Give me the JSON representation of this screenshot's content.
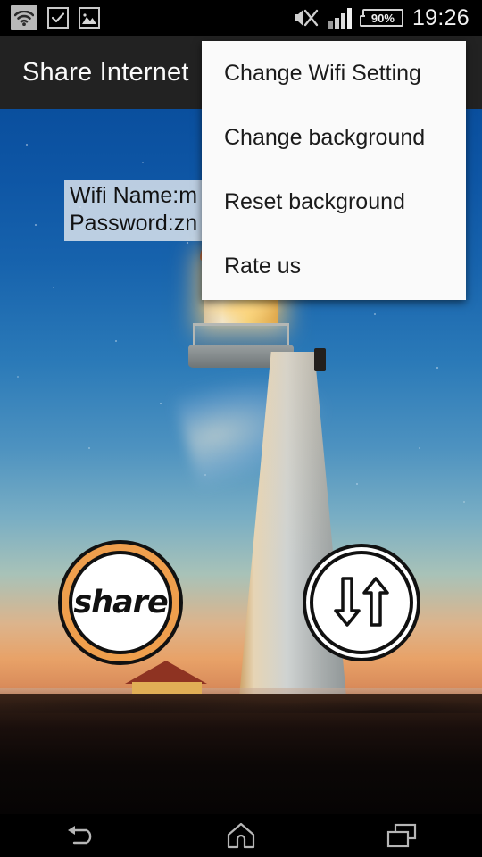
{
  "status_bar": {
    "icons": [
      "wifi-icon",
      "checkbox-icon",
      "image-icon",
      "volume-muted-icon",
      "signal-bars-icon"
    ],
    "battery_percent": "90%",
    "time": "19:26"
  },
  "action_bar": {
    "title": "Share Internet"
  },
  "wifi_info": {
    "name_line": "Wifi Name:m",
    "password_line": "Password:zn"
  },
  "buttons": {
    "share_label": "share",
    "transfer_label": "transfer-arrows"
  },
  "overflow_menu": {
    "items": [
      {
        "label": "Change Wifi Setting"
      },
      {
        "label": "Change background"
      },
      {
        "label": "Reset background"
      },
      {
        "label": "Rate us"
      }
    ]
  },
  "nav_bar": {
    "back": "back-icon",
    "home": "home-icon",
    "recents": "recents-icon"
  },
  "colors": {
    "action_bar": "#222222",
    "menu_bg": "#fafafa",
    "share_ring": "#ef9f4d",
    "status_bar": "#000000"
  }
}
